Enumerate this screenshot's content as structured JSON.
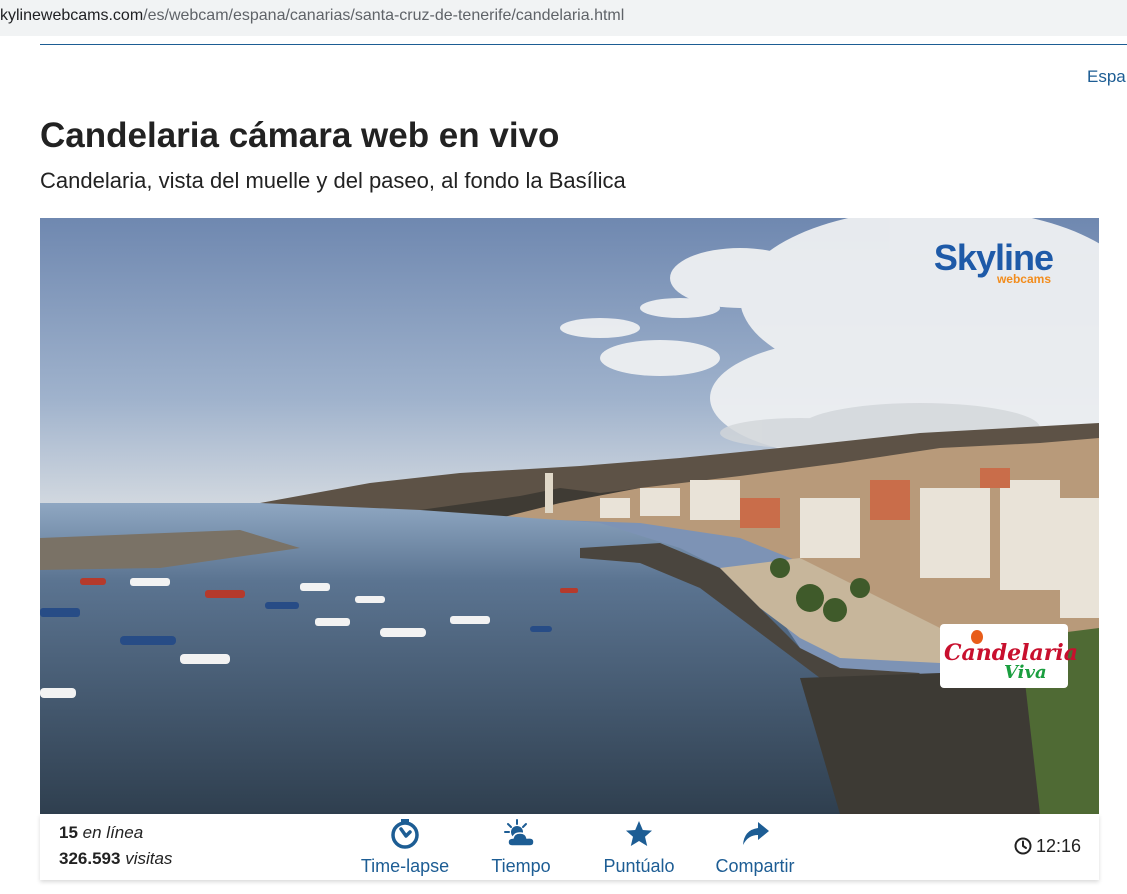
{
  "browser": {
    "url_domain": "skylinewebcams.com",
    "url_path": "/es/webcam/espana/canarias/santa-cruz-de-tenerife/candelaria.html"
  },
  "header": {
    "language_link": "Espa"
  },
  "page": {
    "title": "Candelaria cámara web en vivo",
    "subtitle": "Candelaria, vista del muelle y del paseo, al fondo la Basílica"
  },
  "player": {
    "brand_logo": {
      "main": "Skyline",
      "sub": "webcams"
    },
    "partner_logo": {
      "line1": "Candelaria",
      "line2": "Viva"
    }
  },
  "stats": {
    "online_count": "15",
    "online_label": "en línea",
    "visits_count": "326.593",
    "visits_label": "visitas"
  },
  "actions": [
    {
      "label": "Time-lapse",
      "icon": "timelapse-icon"
    },
    {
      "label": "Tiempo",
      "icon": "weather-icon"
    },
    {
      "label": "Puntúalo",
      "icon": "star-icon"
    },
    {
      "label": "Compartir",
      "icon": "share-icon"
    }
  ],
  "clock": {
    "time": "12:16",
    "icon": "clock-icon"
  },
  "colors": {
    "link": "#1d5d94",
    "title": "#222222",
    "brand_blue": "#1e5aa8",
    "brand_orange": "#f28c1c"
  }
}
